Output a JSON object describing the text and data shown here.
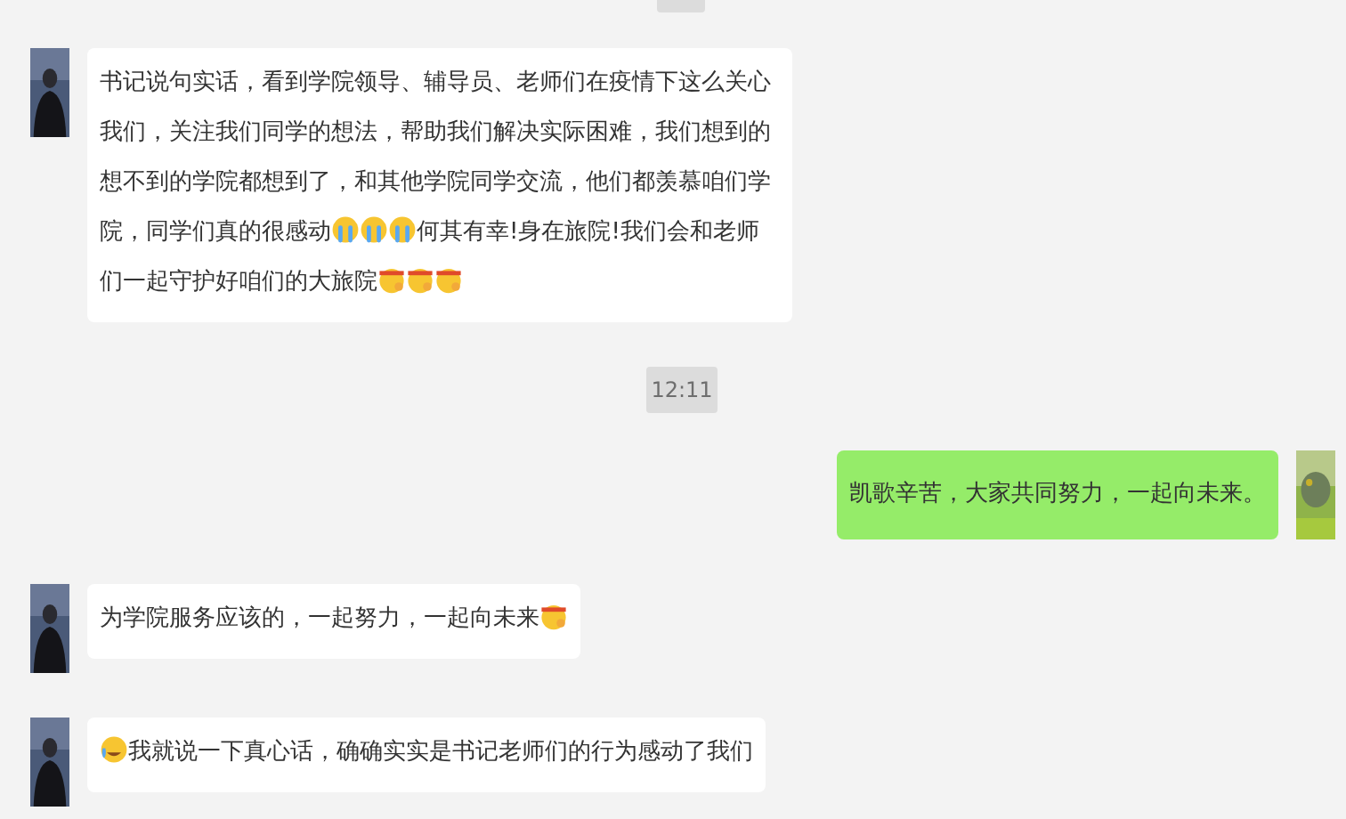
{
  "messages": [
    {
      "kind": "incoming",
      "parts": [
        {
          "kind": "text",
          "text": "书记说句实话，看到学院领导、辅导员、老师们在疫情下这么关心我们，关注我们同学的想法，帮助我们解决实际困难，我们想到的想不到的学院都想到了，和其他学院同学交流，他们都羡慕咱们学院，同学们真的很感动"
        },
        {
          "kind": "crying"
        },
        {
          "kind": "crying"
        },
        {
          "kind": "crying"
        },
        {
          "kind": "text",
          "text": "何其有幸!身在旅院!我们会和老师们一起守护好咱们的大旅院"
        },
        {
          "kind": "headband"
        },
        {
          "kind": "headband"
        },
        {
          "kind": "headband"
        }
      ]
    },
    {
      "kind": "time",
      "text": "12:11"
    },
    {
      "kind": "outgoing",
      "parts": [
        {
          "kind": "text",
          "text": "凯歌辛苦，大家共同努力，一起向未来。"
        }
      ]
    },
    {
      "kind": "incoming",
      "parts": [
        {
          "kind": "text",
          "text": "为学院服务应该的，一起努力，一起向未来"
        },
        {
          "kind": "headband"
        }
      ]
    },
    {
      "kind": "incoming",
      "parts": [
        {
          "kind": "laughing-tears"
        },
        {
          "kind": "text",
          "text": "我就说一下真心话，确确实实是书记老师们的行为感动了我们"
        }
      ]
    }
  ]
}
